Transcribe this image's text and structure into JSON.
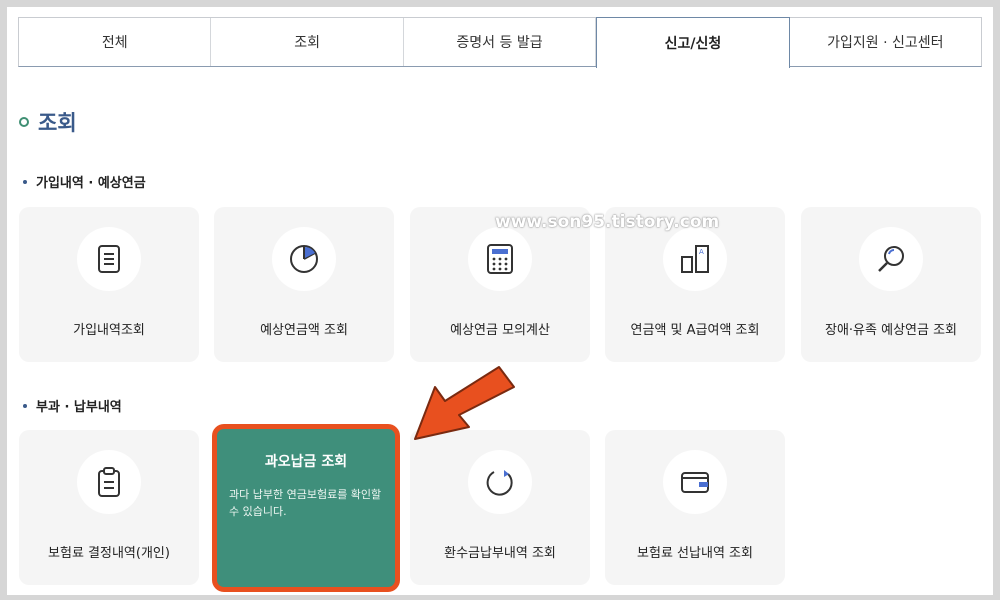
{
  "tabs": [
    {
      "label": "전체",
      "active": false
    },
    {
      "label": "조회",
      "active": false
    },
    {
      "label": "증명서 등 발급",
      "active": false
    },
    {
      "label": "신고/신청",
      "active": true
    },
    {
      "label": "가입지원 · 신고센터",
      "active": false
    }
  ],
  "section": {
    "title": "조회"
  },
  "group1": {
    "title": "가입내역 · 예상연금",
    "cards": [
      {
        "label": "가입내역조회",
        "icon": "document-icon"
      },
      {
        "label": "예상연금액 조회",
        "icon": "pie-chart-icon"
      },
      {
        "label": "예상연금 모의계산",
        "icon": "calculator-icon"
      },
      {
        "label": "연금액 및 A급여액 조회",
        "icon": "bar-compare-icon"
      },
      {
        "label": "장애·유족 예상연금 조회",
        "icon": "magnifier-icon"
      }
    ]
  },
  "group2": {
    "title": "부과 · 납부내역",
    "cards": [
      {
        "label": "보험료 결정내역(개인)",
        "icon": "clipboard-icon"
      },
      {
        "label": "과오납금 조회",
        "description": "과다 납부한 연금보험료를 확인할 수 있습니다.",
        "highlighted": true
      },
      {
        "label": "환수금납부내역 조회",
        "icon": "refresh-icon"
      },
      {
        "label": "보험료 선납내역 조회",
        "icon": "wallet-icon"
      }
    ]
  },
  "watermark": "www.son95.tistory.com",
  "colors": {
    "accent": "#3f8f7b",
    "highlight_border": "#e8501f",
    "title": "#3a5a8a",
    "arrow": "#e8501f"
  }
}
